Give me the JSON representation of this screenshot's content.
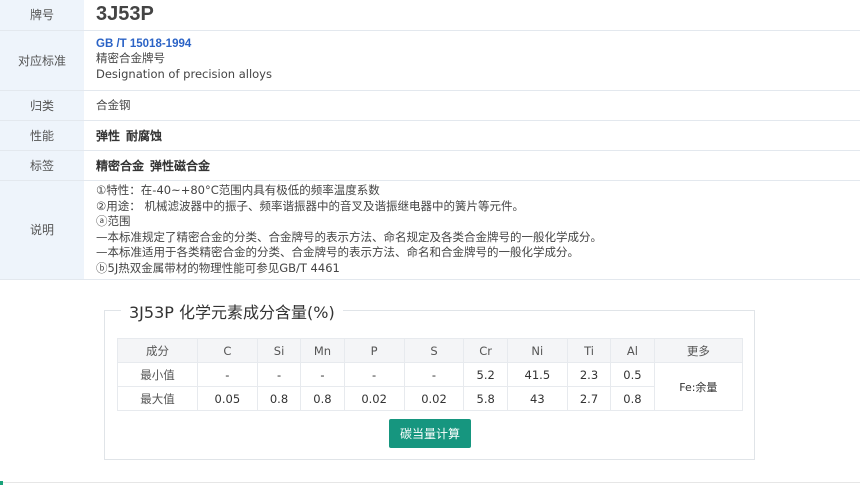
{
  "labels": {
    "brand": "牌号",
    "standard": "对应标准",
    "category": "归类",
    "property": "性能",
    "tags": "标签",
    "description": "说明"
  },
  "brand": "3J53P",
  "standard": {
    "link": "GB /T 15018-1994",
    "name_cn": "精密合金牌号",
    "name_en": "Designation of precision alloys"
  },
  "category": "合金钢",
  "properties": [
    "弹性",
    "耐腐蚀"
  ],
  "tags": [
    "精密合金",
    "弹性磁合金"
  ],
  "description": [
    "①特性：在-40~+80°C范围内具有极低的频率温度系数",
    "②用途：  机械滤波器中的振子、频率谐振器中的音叉及谐振继电器中的簧片等元件。",
    "ⓐ范围",
    "—本标准规定了精密合金的分类、合金牌号的表示方法、命名规定及各类合金牌号的一般化学成分。",
    "—本标准适用于各类精密合金的分类、合金牌号的表示方法、命名和合金牌号的一般化学成分。",
    "ⓑ5J热双金属带材的物理性能可参见GB/T 4461"
  ],
  "chem": {
    "title": "3J53P 化学元素成分含量(%)",
    "headers": [
      "成分",
      "C",
      "Si",
      "Mn",
      "P",
      "S",
      "Cr",
      "Ni",
      "Ti",
      "Al",
      "更多"
    ],
    "min_row": {
      "label": "最小值",
      "values": [
        "-",
        "-",
        "-",
        "-",
        "-",
        "5.2",
        "41.5",
        "2.3",
        "0.5"
      ]
    },
    "max_row": {
      "label": "最大值",
      "values": [
        "0.05",
        "0.8",
        "0.8",
        "0.02",
        "0.02",
        "5.8",
        "43",
        "2.7",
        "0.8"
      ]
    },
    "more": "Fe:余量",
    "button": "碳当量计算"
  }
}
